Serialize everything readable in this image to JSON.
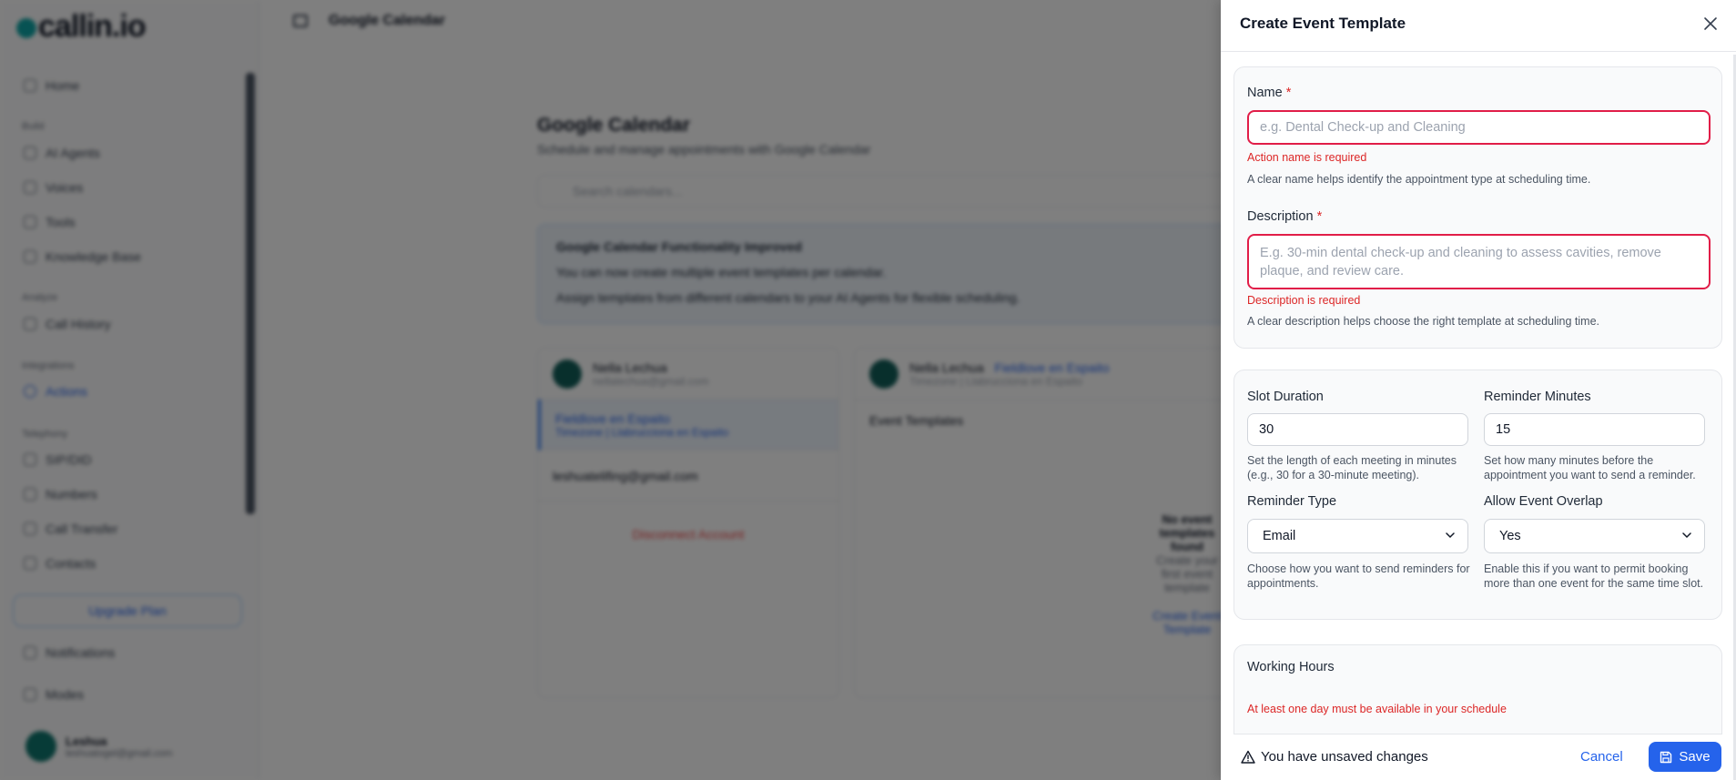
{
  "background": {
    "logo": "callin.io",
    "sidebar": {
      "home": "Home",
      "group_build": "Build",
      "build_items": [
        "AI Agents",
        "Voices",
        "Tools",
        "Knowledge Base"
      ],
      "group_analyze": "Analyze",
      "analyze_items": [
        "Call History"
      ],
      "group_integrations": "Integrations",
      "integrations_items": [
        "Actions"
      ],
      "group_telephony": "Telephony",
      "telephony_items": [
        "SIP/DID",
        "Numbers",
        "Call Transfer",
        "Contacts"
      ],
      "upgrade": "Upgrade Plan",
      "notifications": "Notifications",
      "theme": "Modes",
      "user_name": "Leshua",
      "user_email": "leshuatogel@gmail.com"
    },
    "topbar_title": "Google Calendar",
    "page_title": "Google Calendar",
    "page_subtitle": "Schedule and manage appointments with Google Calendar",
    "search_placeholder": "Search calendars...",
    "info_title": "Google Calendar Functionality Improved",
    "info_line1": "You can now create multiple event templates per calendar.",
    "info_line2": "Assign templates from different calendars to your AI Agents for flexible scheduling.",
    "account_name": "Nella Lechua",
    "account_email": "nellalechua@gmail.com",
    "calendar1": "Fieldlove en Espaito",
    "calendar1_sub": "Timezone | Llabrucciona en Espaito",
    "calendar2": "leshuatelifing@gmail.com",
    "disconnect": "Disconnect Account",
    "detail_name": "Nella Lechua",
    "detail_link": "Fieldlove en Espaito",
    "detail_sub": "Timezone | Llabrucciona en Espaito",
    "event_templates": "Event Templates",
    "empty_title": "No event templates found",
    "empty_sub": "Create your first event template",
    "create_link": "Create Event Template"
  },
  "drawer": {
    "title": "Create Event Template",
    "name": {
      "label": "Name",
      "required_mark": "*",
      "placeholder": "e.g. Dental Check-up and Cleaning",
      "error": "Action name is required",
      "hint": "A clear name helps identify the appointment type at scheduling time."
    },
    "description": {
      "label": "Description",
      "required_mark": "*",
      "placeholder": "E.g. 30-min dental check-up and cleaning to assess cavities, remove plaque, and review care.",
      "error": "Description is required",
      "hint": "A clear description helps choose the right template at scheduling time."
    },
    "slot_duration": {
      "label": "Slot Duration",
      "value": "30",
      "hint": "Set the length of each meeting in minutes (e.g., 30 for a 30-minute meeting)."
    },
    "reminder_minutes": {
      "label": "Reminder Minutes",
      "value": "15",
      "hint": "Set how many minutes before the appointment you want to send a reminder."
    },
    "reminder_type": {
      "label": "Reminder Type",
      "value": "Email",
      "hint": "Choose how you want to send reminders for appointments."
    },
    "allow_overlap": {
      "label": "Allow Event Overlap",
      "value": "Yes",
      "hint": "Enable this if you want to permit booking more than one event for the same time slot."
    },
    "working_hours": {
      "label": "Working Hours",
      "error": "At least one day must be available in your schedule"
    },
    "footer": {
      "unsaved": "You have unsaved changes",
      "cancel": "Cancel",
      "save": "Save"
    },
    "colors": {
      "accent": "#2563eb",
      "error": "#dc2626"
    }
  }
}
